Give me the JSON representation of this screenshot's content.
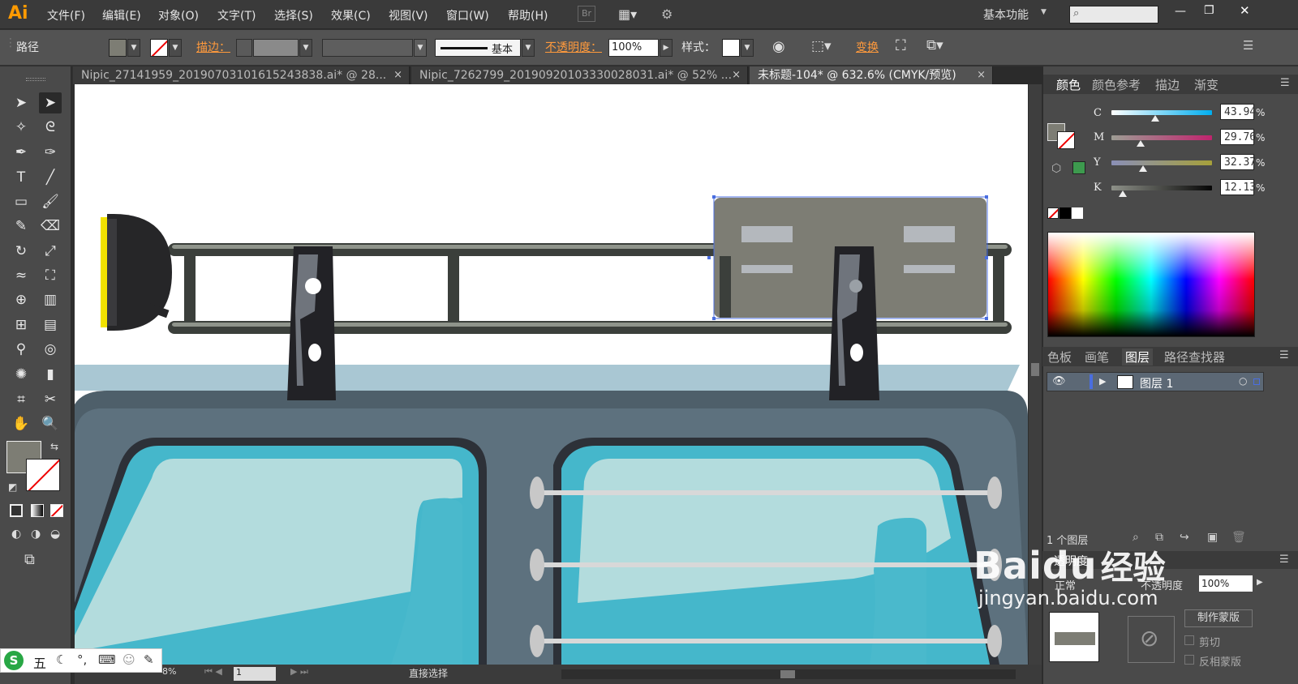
{
  "app": {
    "logo": "Ai"
  },
  "menu": [
    "文件(F)",
    "编辑(E)",
    "对象(O)",
    "文字(T)",
    "选择(S)",
    "效果(C)",
    "视图(V)",
    "窗口(W)",
    "帮助(H)"
  ],
  "menubar_right": {
    "bridge": "Br",
    "workspace": "基本功能",
    "window_controls": [
      "—",
      "❐",
      "✕"
    ]
  },
  "control": {
    "object_type": "路径",
    "stroke_label": "描边：",
    "basic_label": "基本",
    "opacity_label": "不透明度：",
    "opacity_value": "100%",
    "style_label": "样式：",
    "transform_label": "变换"
  },
  "tabs": [
    {
      "label": "Nipic_27141959_20190703101615243838.ai* @ 28..."
    },
    {
      "label": "Nipic_7262799_20190920103330028031.ai* @ 52% ..."
    },
    {
      "label": "未标题-104* @ 632.6% (CMYK/预览)"
    }
  ],
  "colors": {
    "fill_swatch": "#7d7d74",
    "canvas_sky": "#ffffff",
    "car_body": "#5d717e",
    "window": "#45b7cb",
    "rack": "#3b3f3b",
    "accent": "#ff9a00",
    "green_swatch": "#3d9a4e"
  },
  "color_panel": {
    "tabs": [
      "颜色",
      "颜色参考",
      "描边",
      "渐变"
    ],
    "channels": [
      {
        "name": "C",
        "value": "43.94",
        "level": 0.44
      },
      {
        "name": "M",
        "value": "29.76",
        "level": 0.3
      },
      {
        "name": "Y",
        "value": "32.37",
        "level": 0.32
      },
      {
        "name": "K",
        "value": "12.13",
        "level": 0.12
      }
    ],
    "pct_sign": "%"
  },
  "layers_panel": {
    "tabs": [
      "色板",
      "画笔",
      "图层",
      "路径查找器"
    ],
    "layer_name": "图层 1",
    "footer": "1 个图层"
  },
  "transparency_panel": {
    "title": "透明度",
    "mode": "正常",
    "opacity_label": "不透明度",
    "opacity_value": "100%",
    "make_mask": "制作蒙版",
    "clip": "剪切",
    "invert": "反相蒙版"
  },
  "status": {
    "zoom": "8%",
    "page": "1",
    "tool": "直接选择"
  },
  "watermark": {
    "brand": "Baidu",
    "brand_cn": "经验",
    "url": "jingyan.baidu.com"
  },
  "ime": {
    "label": "五"
  },
  "icons": [
    "selection-icon",
    "direct-selection-icon",
    "magic-wand-icon",
    "lasso-icon",
    "pen-icon",
    "curvature-icon",
    "type-icon",
    "line-icon",
    "rectangle-icon",
    "paintbrush-icon",
    "pencil-icon",
    "eraser-icon",
    "rotate-icon",
    "scale-icon",
    "warp-icon",
    "free-transform-icon",
    "shape-builder-icon",
    "perspective-icon",
    "mesh-icon",
    "gradient-icon",
    "eyedropper-icon",
    "blend-icon",
    "symbol-sprayer-icon",
    "graph-icon",
    "artboard-icon",
    "slice-icon",
    "hand-icon",
    "zoom-icon"
  ]
}
